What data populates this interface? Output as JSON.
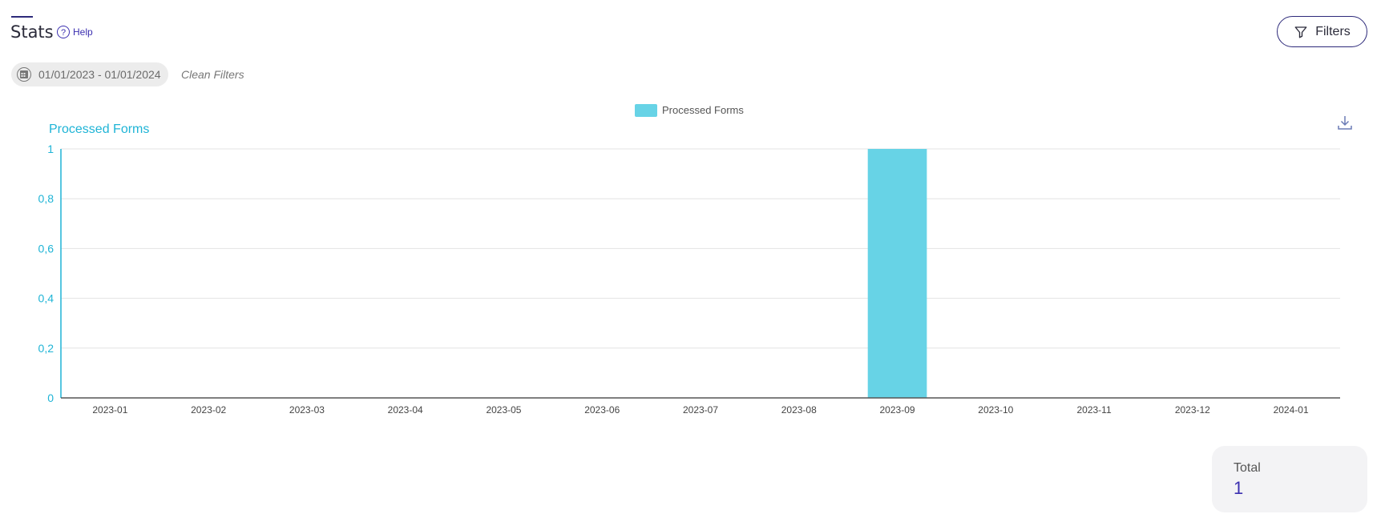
{
  "page": {
    "title": "Stats",
    "help_label": "Help",
    "filters_label": "Filters"
  },
  "filters": {
    "date_range": "01/01/2023 - 01/01/2024",
    "clean_label": "Clean Filters"
  },
  "total": {
    "label": "Total",
    "value": "1"
  },
  "colors": {
    "bar": "#67d3e6",
    "axis_accent": "#1fb4d6",
    "brand": "#2d2a7a"
  },
  "icons": [
    "help-icon",
    "filter-icon",
    "calendar-icon",
    "download-icon"
  ],
  "chart_data": {
    "type": "bar",
    "ylabel": "Processed Forms",
    "categories": [
      "2023-01",
      "2023-02",
      "2023-03",
      "2023-04",
      "2023-05",
      "2023-06",
      "2023-07",
      "2023-08",
      "2023-09",
      "2023-10",
      "2023-11",
      "2023-12",
      "2024-01"
    ],
    "series": [
      {
        "name": "Processed Forms",
        "values": [
          0,
          0,
          0,
          0,
          0,
          0,
          0,
          0,
          1,
          0,
          0,
          0,
          0
        ]
      }
    ],
    "ylim": [
      0,
      1
    ],
    "yticks": [
      "0",
      "0,2",
      "0,4",
      "0,6",
      "0,8",
      "1"
    ],
    "legend": "top-center",
    "grid": true
  }
}
